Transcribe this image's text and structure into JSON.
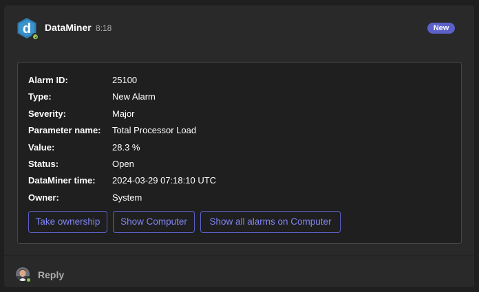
{
  "message": {
    "sender": "DataMiner",
    "time": "8:18",
    "badge": "New",
    "avatar_icon": "dataminer-logo-icon",
    "avatar_letter": "d"
  },
  "card": {
    "facts": [
      {
        "label": "Alarm ID:",
        "value": "25100"
      },
      {
        "label": "Type:",
        "value": "New Alarm"
      },
      {
        "label": "Severity:",
        "value": "Major"
      },
      {
        "label": "Parameter name:",
        "value": "Total Processor Load"
      },
      {
        "label": "Value:",
        "value": "28.3 %"
      },
      {
        "label": "Status:",
        "value": "Open"
      },
      {
        "label": "DataMiner time:",
        "value": "2024-03-29 07:18:10 UTC"
      },
      {
        "label": "Owner:",
        "value": "System"
      }
    ],
    "actions": [
      {
        "label": "Take ownership"
      },
      {
        "label": "Show Computer"
      },
      {
        "label": "Show all alarms on Computer"
      }
    ]
  },
  "reply": {
    "label": "Reply",
    "avatar_icon": "user-avatar-icon"
  },
  "colors": {
    "background": "#1f1f1f",
    "frame": "#292929",
    "accent": "#5b5fc7",
    "accent_text": "#7f85f5",
    "presence_available": "#92c353",
    "muted_text": "#adadad"
  }
}
